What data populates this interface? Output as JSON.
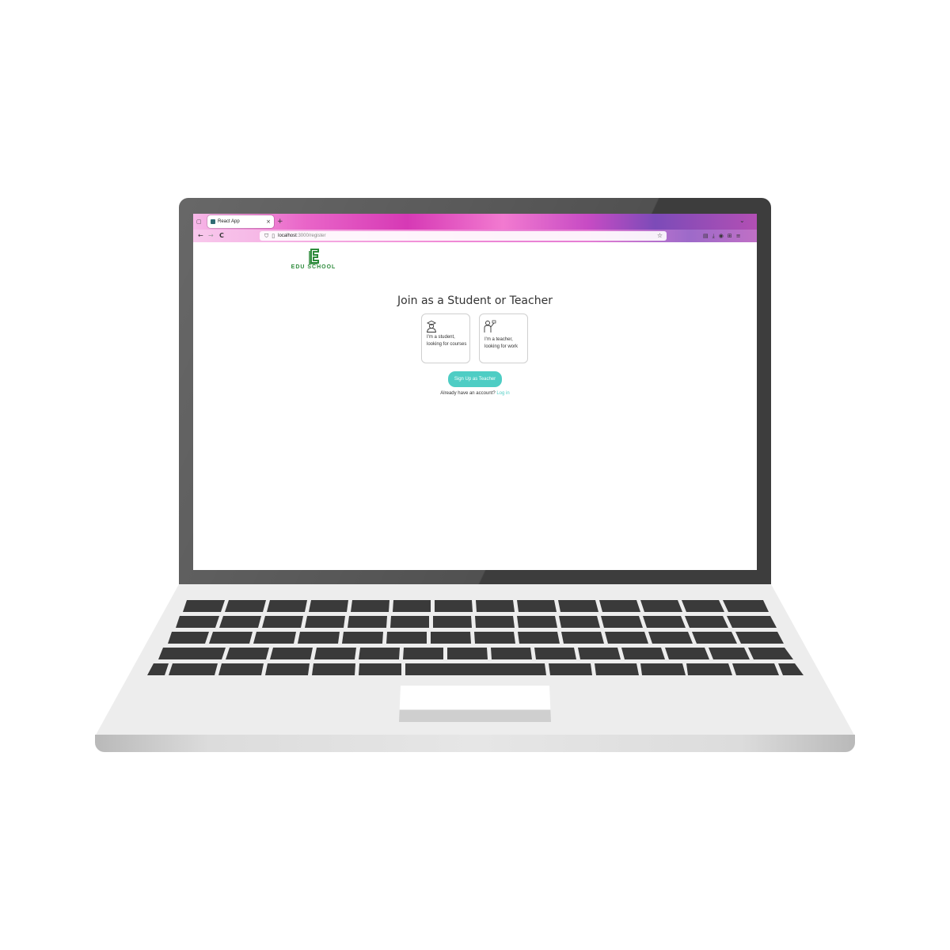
{
  "browser": {
    "tab_title": "React App",
    "tab_close": "×",
    "new_tab": "+",
    "url_host": "localhost",
    "url_path": ":3000/register",
    "back": "←",
    "forward": "→",
    "reload": "C"
  },
  "page": {
    "logo_text": "EDU SCHOOL",
    "heading": "Join as a Student or Teacher",
    "cards": [
      {
        "line1": "I'm a student,",
        "line2": "looking for courses"
      },
      {
        "line1": "I'm a teacher,",
        "line2": "looking for work"
      }
    ],
    "signup_button": "Sign Up as Teacher",
    "login_prompt": "Already have an account?",
    "login_link": "Log in"
  },
  "colors": {
    "accent": "#4ecdc4",
    "logo": "#2e8b3c"
  }
}
